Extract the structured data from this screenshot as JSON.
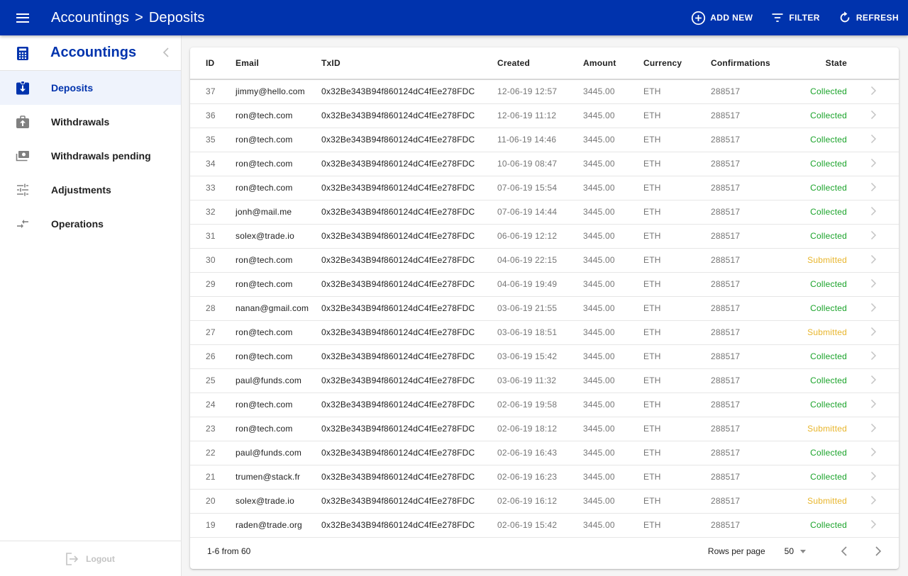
{
  "header": {
    "breadcrumb": [
      "Accountings",
      "Deposits"
    ],
    "separator": ">",
    "actions": [
      {
        "icon": "add-circle-icon",
        "label": "ADD NEW"
      },
      {
        "icon": "filter-icon",
        "label": "FILTER"
      },
      {
        "icon": "refresh-icon",
        "label": "REFRESH"
      }
    ]
  },
  "sidebar": {
    "title": "Accountings",
    "title_icon": "calculator-icon",
    "items": [
      {
        "label": "Deposits",
        "icon": "deposit-icon",
        "active": true
      },
      {
        "label": "Withdrawals",
        "icon": "withdrawal-icon",
        "active": false
      },
      {
        "label": "Withdrawals pending",
        "icon": "money-pending-icon",
        "active": false
      },
      {
        "label": "Adjustments",
        "icon": "tune-icon",
        "active": false
      },
      {
        "label": "Operations",
        "icon": "compare-arrows-icon",
        "active": false
      }
    ],
    "logout_label": "Logout"
  },
  "colors": {
    "brand": "#0033ad",
    "collected": "#1aa32a",
    "submitted": "#e8b52b",
    "active_bg": "#eff3fc"
  },
  "table": {
    "columns": [
      "ID",
      "Email",
      "TxID",
      "Created",
      "Amount",
      "Currency",
      "Confirmations",
      "State"
    ],
    "rows": [
      {
        "id": "37",
        "email": "jimmy@hello.com",
        "txid": "0x32Be343B94f860124dC4fEe278FDC",
        "created": "12-06-19 12:57",
        "amount": "3445.00",
        "currency": "ETH",
        "confirmations": "288517",
        "state": "Collected"
      },
      {
        "id": "36",
        "email": "ron@tech.com",
        "txid": "0x32Be343B94f860124dC4fEe278FDC",
        "created": "12-06-19 11:12",
        "amount": "3445.00",
        "currency": "ETH",
        "confirmations": "288517",
        "state": "Collected"
      },
      {
        "id": "35",
        "email": "ron@tech.com",
        "txid": "0x32Be343B94f860124dC4fEe278FDC",
        "created": "11-06-19 14:46",
        "amount": "3445.00",
        "currency": "ETH",
        "confirmations": "288517",
        "state": "Collected"
      },
      {
        "id": "34",
        "email": "ron@tech.com",
        "txid": "0x32Be343B94f860124dC4fEe278FDC",
        "created": "10-06-19 08:47",
        "amount": "3445.00",
        "currency": "ETH",
        "confirmations": "288517",
        "state": "Collected"
      },
      {
        "id": "33",
        "email": "ron@tech.com",
        "txid": "0x32Be343B94f860124dC4fEe278FDC",
        "created": "07-06-19 15:54",
        "amount": "3445.00",
        "currency": "ETH",
        "confirmations": "288517",
        "state": "Collected"
      },
      {
        "id": "32",
        "email": "jonh@mail.me",
        "txid": "0x32Be343B94f860124dC4fEe278FDC",
        "created": "07-06-19 14:44",
        "amount": "3445.00",
        "currency": "ETH",
        "confirmations": "288517",
        "state": "Collected"
      },
      {
        "id": "31",
        "email": "solex@trade.io",
        "txid": "0x32Be343B94f860124dC4fEe278FDC",
        "created": "06-06-19 12:12",
        "amount": "3445.00",
        "currency": "ETH",
        "confirmations": "288517",
        "state": "Collected"
      },
      {
        "id": "30",
        "email": "ron@tech.com",
        "txid": "0x32Be343B94f860124dC4fEe278FDC",
        "created": "04-06-19 22:15",
        "amount": "3445.00",
        "currency": "ETH",
        "confirmations": "288517",
        "state": "Submitted"
      },
      {
        "id": "29",
        "email": "ron@tech.com",
        "txid": "0x32Be343B94f860124dC4fEe278FDC",
        "created": "04-06-19 19:49",
        "amount": "3445.00",
        "currency": "ETH",
        "confirmations": "288517",
        "state": "Collected"
      },
      {
        "id": "28",
        "email": "nanan@gmail.com",
        "txid": "0x32Be343B94f860124dC4fEe278FDC",
        "created": "03-06-19 21:55",
        "amount": "3445.00",
        "currency": "ETH",
        "confirmations": "288517",
        "state": "Collected"
      },
      {
        "id": "27",
        "email": "ron@tech.com",
        "txid": "0x32Be343B94f860124dC4fEe278FDC",
        "created": "03-06-19 18:51",
        "amount": "3445.00",
        "currency": "ETH",
        "confirmations": "288517",
        "state": "Submitted"
      },
      {
        "id": "26",
        "email": "ron@tech.com",
        "txid": "0x32Be343B94f860124dC4fEe278FDC",
        "created": "03-06-19 15:42",
        "amount": "3445.00",
        "currency": "ETH",
        "confirmations": "288517",
        "state": "Collected"
      },
      {
        "id": "25",
        "email": "paul@funds.com",
        "txid": "0x32Be343B94f860124dC4fEe278FDC",
        "created": "03-06-19 11:32",
        "amount": "3445.00",
        "currency": "ETH",
        "confirmations": "288517",
        "state": "Collected"
      },
      {
        "id": "24",
        "email": "ron@tech.com",
        "txid": "0x32Be343B94f860124dC4fEe278FDC",
        "created": "02-06-19 19:58",
        "amount": "3445.00",
        "currency": "ETH",
        "confirmations": "288517",
        "state": "Collected"
      },
      {
        "id": "23",
        "email": "ron@tech.com",
        "txid": "0x32Be343B94f860124dC4fEe278FDC",
        "created": "02-06-19 18:12",
        "amount": "3445.00",
        "currency": "ETH",
        "confirmations": "288517",
        "state": "Submitted"
      },
      {
        "id": "22",
        "email": "paul@funds.com",
        "txid": "0x32Be343B94f860124dC4fEe278FDC",
        "created": "02-06-19 16:43",
        "amount": "3445.00",
        "currency": "ETH",
        "confirmations": "288517",
        "state": "Collected"
      },
      {
        "id": "21",
        "email": "trumen@stack.fr",
        "txid": "0x32Be343B94f860124dC4fEe278FDC",
        "created": "02-06-19 16:23",
        "amount": "3445.00",
        "currency": "ETH",
        "confirmations": "288517",
        "state": "Collected"
      },
      {
        "id": "20",
        "email": "solex@trade.io",
        "txid": "0x32Be343B94f860124dC4fEe278FDC",
        "created": "02-06-19 16:12",
        "amount": "3445.00",
        "currency": "ETH",
        "confirmations": "288517",
        "state": "Submitted"
      },
      {
        "id": "19",
        "email": "raden@trade.org",
        "txid": "0x32Be343B94f860124dC4fEe278FDC",
        "created": "02-06-19 15:42",
        "amount": "3445.00",
        "currency": "ETH",
        "confirmations": "288517",
        "state": "Collected"
      }
    ]
  },
  "pagination": {
    "range_text": "1-6 from 60",
    "rows_per_page_label": "Rows per page",
    "rows_per_page_value": "50"
  }
}
